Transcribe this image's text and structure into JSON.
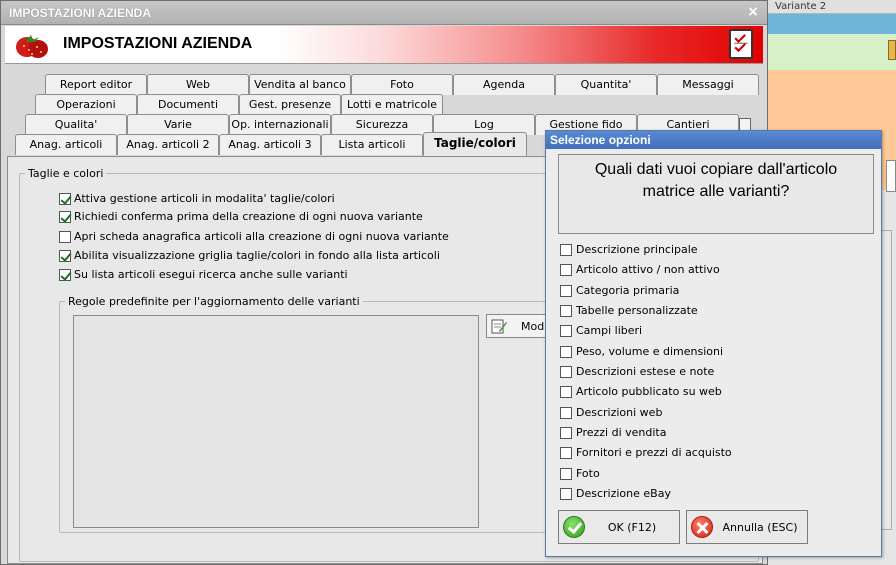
{
  "background_window": {
    "title": "Variante 2"
  },
  "main_window": {
    "title": "IMPOSTAZIONI AZIENDA",
    "close_glyph": "×",
    "banner_title": "IMPOSTAZIONI AZIENDA",
    "logo_icon": "strawberry-icon",
    "settings_icon": "checklist-icon"
  },
  "tabs": {
    "row1": [
      "Report editor",
      "Web",
      "Vendita al banco",
      "Foto",
      "Agenda",
      "Quantita'",
      "Messaggi"
    ],
    "row2": [
      "Operazioni",
      "Documenti",
      "Gest. presenze",
      "Lotti e matricole"
    ],
    "row3": [
      "Qualita'",
      "Varie",
      "Op. internazionali",
      "Sicurezza",
      "Log",
      "Gestione fido",
      "Cantieri"
    ],
    "row4": [
      "Anag. articoli",
      "Anag. articoli 2",
      "Anag. articoli 3",
      "Lista articoli",
      "Taglie/colori"
    ],
    "active": "Taglie/colori"
  },
  "taglie_group": {
    "legend": "Taglie e colori",
    "options": [
      {
        "label": "Attiva gestione articoli in modalita' taglie/colori",
        "checked": true
      },
      {
        "label": "Richiedi conferma prima della creazione di ogni nuova variante",
        "checked": true
      },
      {
        "label": "Apri scheda anagrafica articoli alla creazione di ogni nuova variante",
        "checked": false
      },
      {
        "label": "Abilita visualizzazione griglia taglie/colori in fondo alla lista articoli",
        "checked": true
      },
      {
        "label": "Su lista articoli esegui ricerca anche sulle varianti",
        "checked": true
      }
    ]
  },
  "regole_group": {
    "legend": "Regole predefinite per l'aggiornamento delle varianti",
    "modify_button": "Mod"
  },
  "dialog": {
    "title": "Selezione opzioni",
    "question_line1": "Quali dati vuoi copiare dall'articolo",
    "question_line2": "matrice alle varianti?",
    "options": [
      "Descrizione principale",
      "Articolo attivo / non attivo",
      "Categoria primaria",
      "Tabelle personalizzate",
      "Campi liberi",
      "Peso, volume e dimensioni",
      "Descrizioni estese e note",
      "Articolo pubblicato su web",
      "Descrizioni web",
      "Prezzi di vendita",
      "Fornitori e prezzi di acquisto",
      "Foto",
      "Descrizione eBay"
    ],
    "ok_button": "OK (F12)",
    "cancel_button": "Annulla (ESC)"
  }
}
